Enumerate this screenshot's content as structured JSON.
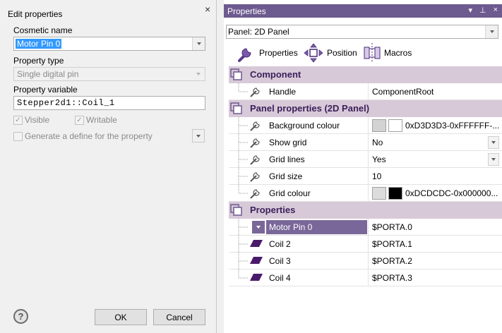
{
  "dialog": {
    "title": "Edit properties",
    "cosmetic_name_label": "Cosmetic name",
    "cosmetic_name_value": "Motor Pin 0",
    "property_type_label": "Property type",
    "property_type_value": "Single digital pin",
    "property_variable_label": "Property variable",
    "property_variable_value": "Stepper2d1::Coil_1",
    "visible_label": "Visible",
    "writable_label": "Writable",
    "generate_define_label": "Generate a define for the property",
    "ok_label": "OK",
    "cancel_label": "Cancel",
    "help_glyph": "?",
    "close_glyph": "×"
  },
  "panel": {
    "title": "Properties",
    "selector_value": "Panel: 2D Panel",
    "tabs": [
      {
        "label": "Properties",
        "icon": "wrench-icon"
      },
      {
        "label": "Position",
        "icon": "move-arrows-icon"
      },
      {
        "label": "Macros",
        "icon": "macros-icon"
      }
    ],
    "sections": [
      {
        "title": "Component",
        "rows": [
          {
            "name": "Handle",
            "value": "ComponentRoot"
          }
        ]
      },
      {
        "title": "Panel properties (2D Panel)",
        "rows": [
          {
            "name": "Background colour",
            "value": "0xD3D3D3-0xFFFFFF-...",
            "swatch1": "#d3d3d3",
            "swatch2": "#ffffff"
          },
          {
            "name": "Show grid",
            "value": "No"
          },
          {
            "name": "Grid lines",
            "value": "Yes"
          },
          {
            "name": "Grid size",
            "value": "10"
          },
          {
            "name": "Grid colour",
            "value": "0xDCDCDC-0x000000...",
            "swatch1": "#dcdcdc",
            "swatch2": "#000000"
          }
        ]
      },
      {
        "title": "Properties",
        "rows": [
          {
            "name": "Motor Pin 0",
            "value": "$PORTA.0"
          },
          {
            "name": "Coil 2",
            "value": "$PORTA.1"
          },
          {
            "name": "Coil 3",
            "value": "$PORTA.2"
          },
          {
            "name": "Coil 4",
            "value": "$PORTA.3"
          }
        ]
      }
    ]
  },
  "colors": {
    "accent": "#6d5a8f",
    "category_bg": "#d8c9d8",
    "selection": "#3399ff"
  }
}
